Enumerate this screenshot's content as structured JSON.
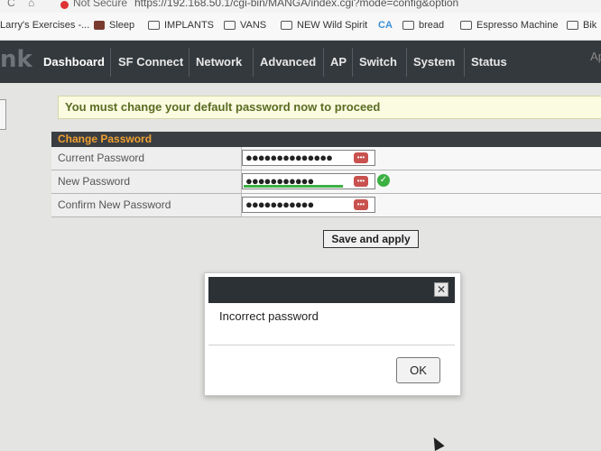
{
  "browser": {
    "back_glyph": "C",
    "home_glyph": "⌂",
    "security_label": "Not Secure",
    "url": "https://192.168.50.1/cgi-bin/MANGA/index.cgi?mode=config&option",
    "bookmarks": [
      "Larry's Exercises -...",
      "Sleep",
      "IMPLANTS",
      "VANS",
      "NEW Wild Spirit",
      "bread",
      "Espresso Machine",
      "Bik"
    ]
  },
  "nav": {
    "brand": "nk",
    "tabs": [
      "Dashboard",
      "SF Connect",
      "Network",
      "Advanced",
      "AP",
      "Switch",
      "System",
      "Status"
    ],
    "active": "Dashboard",
    "right": "Ap"
  },
  "notice": "You must change your default password now to proceed",
  "form": {
    "title": "Change Password",
    "rows": [
      {
        "label": "Current Password",
        "value": "●●●●●●●●●●●●●●"
      },
      {
        "label": "New Password",
        "value": "●●●●●●●●●●●"
      },
      {
        "label": "Confirm New Password",
        "value": "●●●●●●●●●●●"
      }
    ],
    "reveal_glyph": "•••",
    "check_glyph": "✓",
    "save_label": "Save and apply"
  },
  "dialog": {
    "message": "Incorrect password",
    "ok_label": "OK",
    "close_glyph": "✕"
  },
  "colors": {
    "navbar": "#34393d",
    "notice_text": "#5a6b22",
    "table_header_text": "#f0a032",
    "strength_good": "#3cb043"
  }
}
